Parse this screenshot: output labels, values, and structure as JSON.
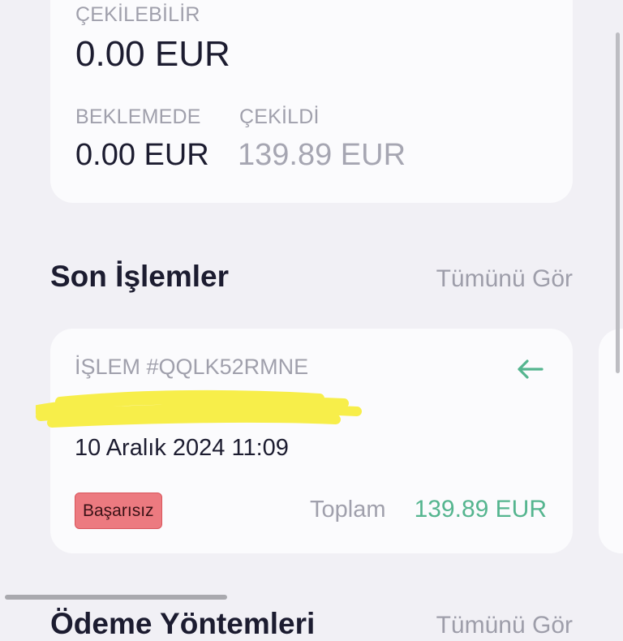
{
  "balance": {
    "withdrawable_label": "ÇEKİLEBİLİR",
    "withdrawable_amount": "0.00 EUR",
    "pending_label": "BEKLEMEDE",
    "pending_amount": "0.00 EUR",
    "withdrawn_label": "ÇEKİLDİ",
    "withdrawn_amount": "139.89 EUR"
  },
  "recent": {
    "title": "Son İşlemler",
    "see_all": "Tümünü Gör"
  },
  "transaction": {
    "id_label": "İŞLEM #QQLK52RMNE",
    "date": "10 Aralık 2024 11:09",
    "status": "Başarısız",
    "total_label": "Toplam",
    "total_amount": "139.89 EUR",
    "direction_icon": "arrow-left-icon"
  },
  "payment_methods": {
    "title": "Ödeme Yöntemleri",
    "see_all": "Tümünü Gör"
  },
  "colors": {
    "background": "#f1f0f5",
    "card": "#fbfbfd",
    "success_green": "#55b58f",
    "failed_badge": "#ec7a80",
    "redaction_yellow": "#f7ee4a"
  }
}
